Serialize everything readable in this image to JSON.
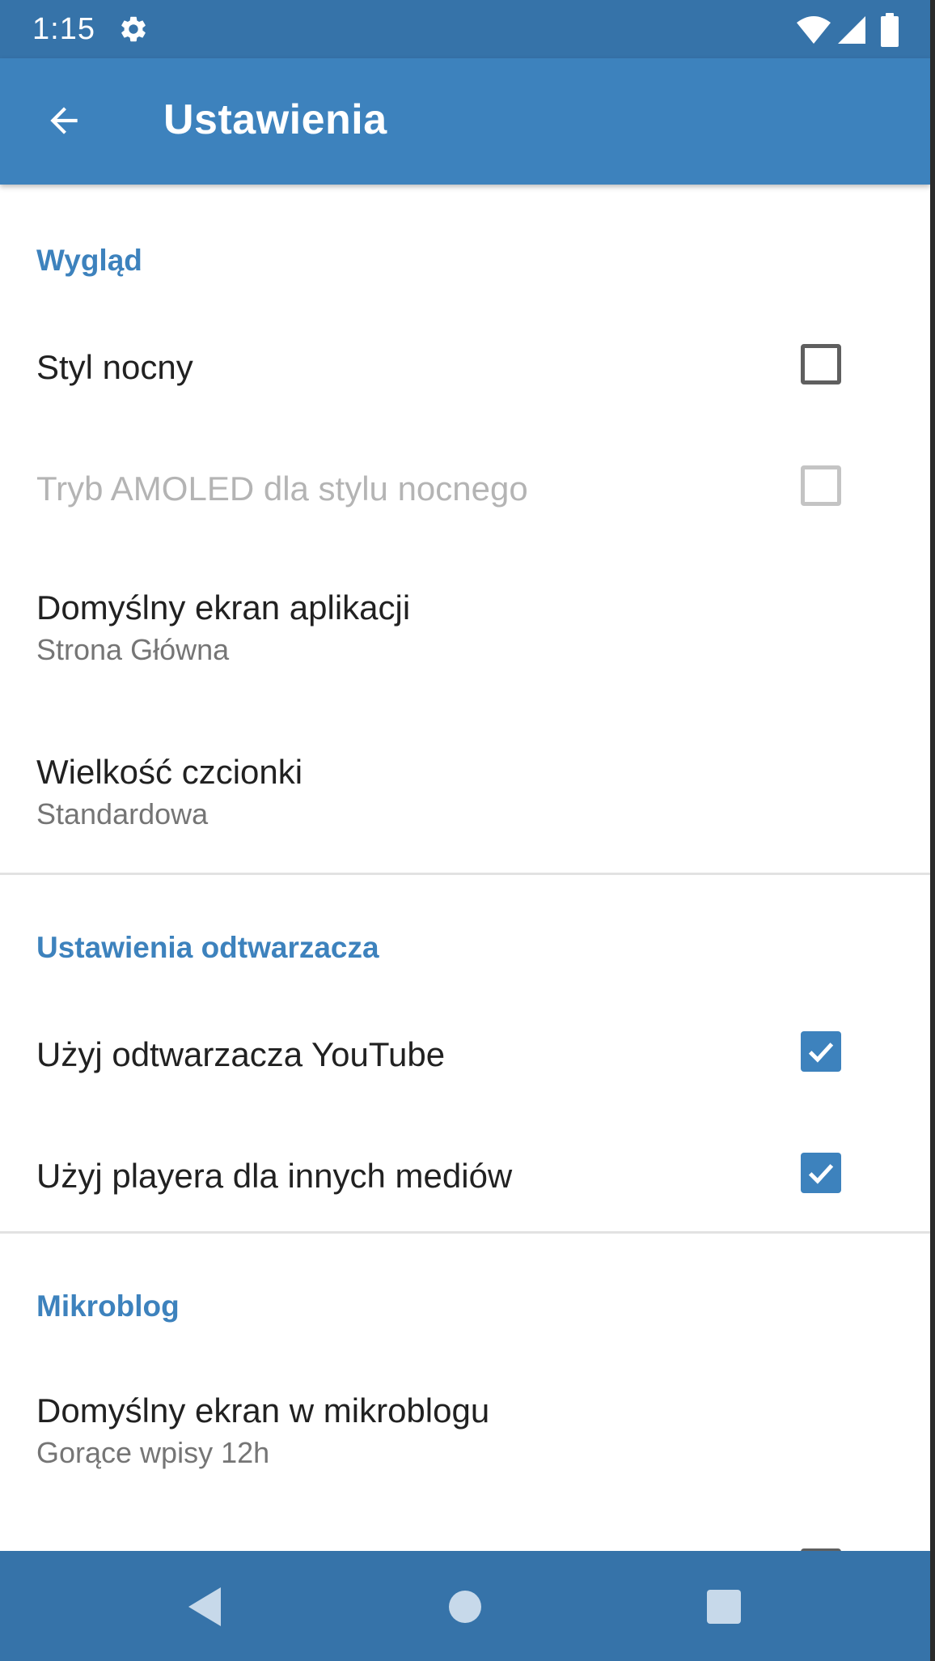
{
  "status_bar": {
    "time": "1:15",
    "icons": [
      "gear-icon",
      "wifi-icon",
      "signal-icon",
      "battery-icon"
    ]
  },
  "app_bar": {
    "title": "Ustawienia",
    "back_icon": "arrow-back-icon"
  },
  "sections": {
    "appearance": {
      "header": "Wygląd",
      "night_style": {
        "title": "Styl nocny",
        "checked": false
      },
      "amoled": {
        "title": "Tryb AMOLED dla stylu nocnego",
        "checked": false,
        "enabled": false
      },
      "default_screen": {
        "title": "Domyślny ekran aplikacji",
        "summary": "Strona Główna"
      },
      "font_size": {
        "title": "Wielkość czcionki",
        "summary": "Standardowa"
      }
    },
    "player": {
      "header": "Ustawienia odtwarzacza",
      "youtube_player": {
        "title": "Użyj odtwarzacza YouTube",
        "checked": true
      },
      "other_media_player": {
        "title": "Użyj playera dla innych mediów",
        "checked": true
      }
    },
    "microblog": {
      "header": "Mikroblog",
      "default_screen": {
        "title": "Domyślny ekran w mikroblogu",
        "summary": "Gorące wpisy 12h"
      }
    }
  },
  "nav_bar": {
    "icons": [
      "nav-back-icon",
      "nav-home-icon",
      "nav-recents-icon"
    ]
  },
  "colors": {
    "accent": "#3d82bd",
    "status_bar": "#3673a9",
    "text_primary": "#212121",
    "text_secondary": "#757575",
    "text_disabled": "#b4b4b4"
  }
}
